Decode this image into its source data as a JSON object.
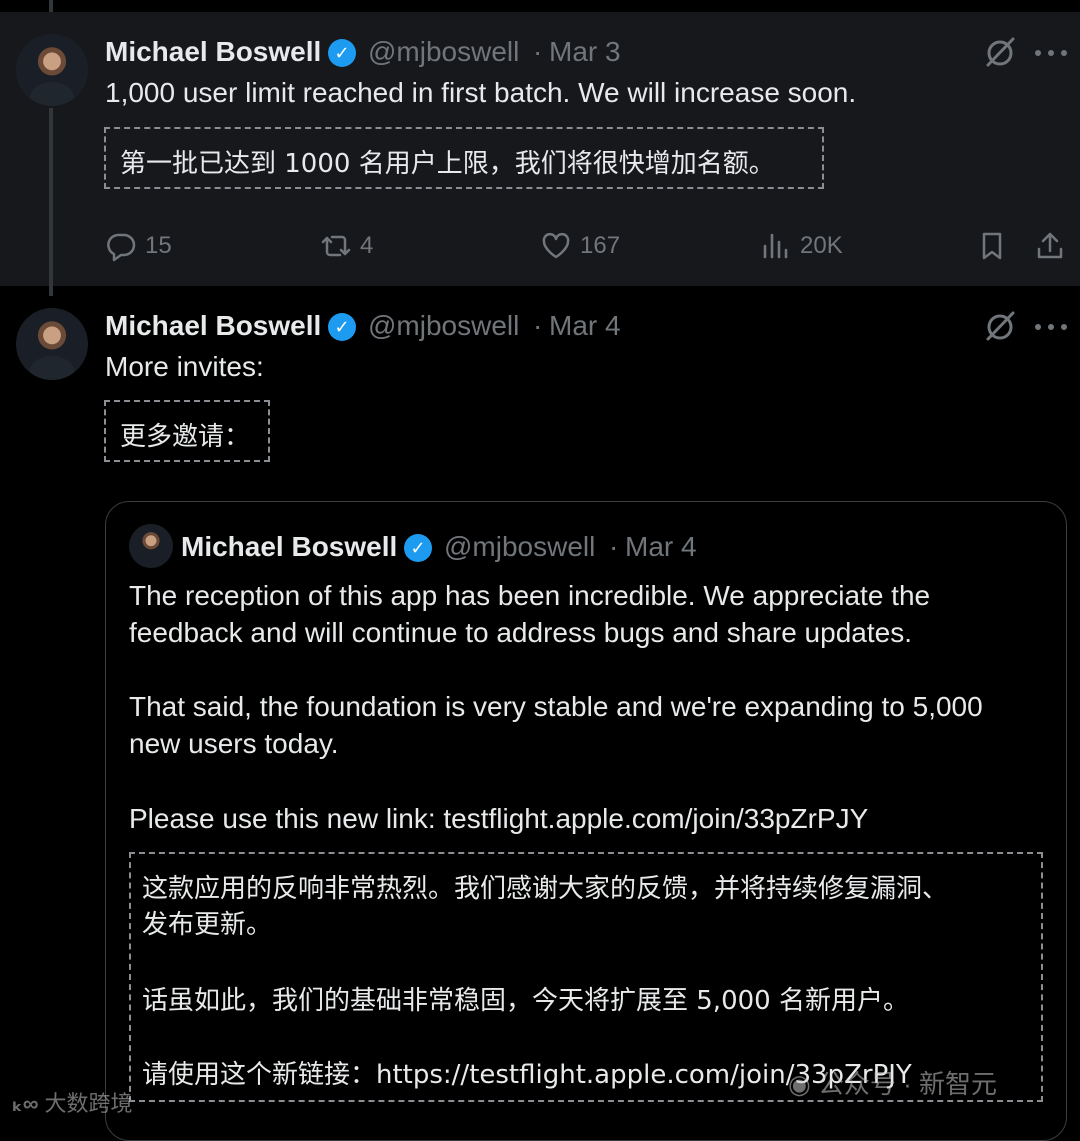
{
  "tweet1": {
    "author_name": "Michael Boswell",
    "handle": "@mjboswell",
    "separator": "·",
    "date": "Mar 3",
    "text": "1,000 user limit reached in first batch. We will increase soon.",
    "translation": "第一批已达到 1000 名用户上限，我们将很快增加名额。",
    "replies": "15",
    "reposts": "4",
    "likes": "167",
    "views": "20K"
  },
  "tweet2": {
    "author_name": "Michael Boswell",
    "handle": "@mjboswell",
    "separator": "·",
    "date": "Mar 4",
    "text": "More invites:",
    "translation": "更多邀请："
  },
  "quote": {
    "author_name": "Michael Boswell",
    "handle": "@mjboswell",
    "separator": "·",
    "date": "Mar 4",
    "p1_line1": "The reception of this app has been incredible. We appreciate the",
    "p1_line2": "feedback and will continue to address bugs and share updates.",
    "p2_line1": "That said, the foundation is very stable and we're expanding to 5,000",
    "p2_line2": "new users today.",
    "p3": "Please use this new link: testflight.apple.com/join/33pZrPJY",
    "trans_line1": "这款应用的反响非常热烈。我们感谢大家的反馈，并将持续修复漏洞、",
    "trans_line2": "发布更新。",
    "trans_line3": "话虽如此，我们的基础非常稳固，今天将扩展至 5,000 名新用户。",
    "trans_line4": "请使用这个新链接：https://testflight.apple.com/join/33pZrPJY"
  },
  "watermarks": {
    "left": "大数跨境",
    "right_a": "公众号",
    "right_b": "新智元"
  },
  "icons": {
    "verified": "verified-badge-icon",
    "grok": "grok-icon",
    "more": "more-icon",
    "reply": "reply-icon",
    "repost": "repost-icon",
    "like": "like-icon",
    "views": "views-icon",
    "bookmark": "bookmark-icon",
    "share": "share-icon"
  },
  "colors": {
    "background": "#000000",
    "highlight_background": "#16181c",
    "text": "#e7e9ea",
    "muted": "#71767b",
    "verified_blue": "#1d9bf0"
  }
}
